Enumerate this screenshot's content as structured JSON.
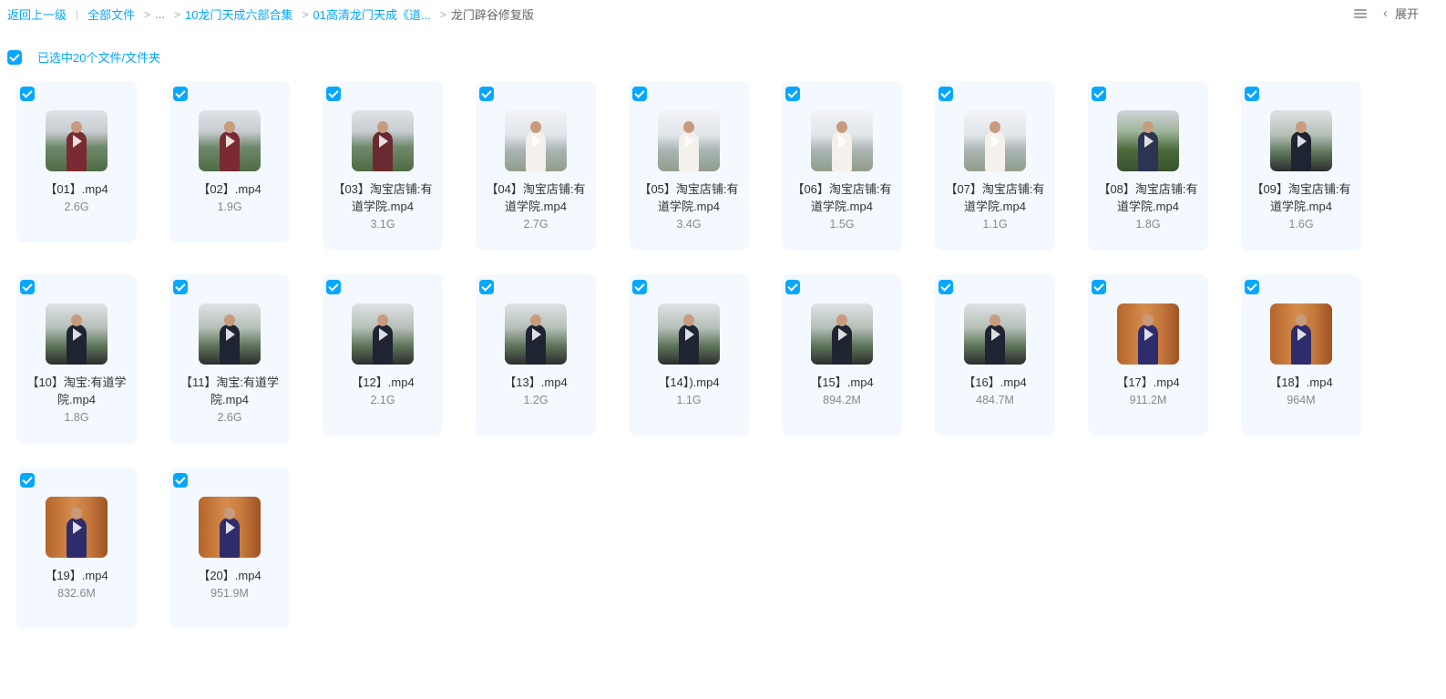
{
  "breadcrumb": {
    "back_label": "返回上一级",
    "items": [
      "全部文件",
      "...",
      "10龙门天成六部合集",
      "01高清龙门天成《道..."
    ],
    "current": "龙门辟谷修复版"
  },
  "toolbar": {
    "expand_label": "展开"
  },
  "selection": {
    "text": "已选中20个文件/文件夹"
  },
  "colors": {
    "accent": "#06a7ff",
    "card_bg": "#f3f9ff"
  },
  "files": [
    {
      "name": "【01】.mp4",
      "size": "2.6G",
      "thumb": "bg-mountain",
      "robe": "#7a2a32"
    },
    {
      "name": "【02】.mp4",
      "size": "1.9G",
      "thumb": "bg-mountain",
      "robe": "#7a2a32"
    },
    {
      "name": "【03】淘宝店铺:有道学院.mp4",
      "size": "3.1G",
      "thumb": "bg-mountain",
      "robe": "#6b2a30"
    },
    {
      "name": "【04】淘宝店铺:有道学院.mp4",
      "size": "2.7G",
      "thumb": "bg-mist",
      "robe": "#f4f0ec"
    },
    {
      "name": "【05】淘宝店铺:有道学院.mp4",
      "size": "3.4G",
      "thumb": "bg-mist",
      "robe": "#f4f0ec"
    },
    {
      "name": "【06】淘宝店铺:有道学院.mp4",
      "size": "1.5G",
      "thumb": "bg-mist",
      "robe": "#f4f0ec"
    },
    {
      "name": "【07】淘宝店铺:有道学院.mp4",
      "size": "1.1G",
      "thumb": "bg-mist",
      "robe": "#f4f0ec"
    },
    {
      "name": "【08】淘宝店铺:有道学院.mp4",
      "size": "1.8G",
      "thumb": "bg-forest",
      "robe": "#2b3450"
    },
    {
      "name": "【09】淘宝店铺:有道学院.mp4",
      "size": "1.6G",
      "thumb": "bg-rail",
      "robe": "#1f2433"
    },
    {
      "name": "【10】淘宝:有道学院.mp4",
      "size": "1.8G",
      "thumb": "bg-rail",
      "robe": "#1f2433"
    },
    {
      "name": "【11】淘宝:有道学院.mp4",
      "size": "2.6G",
      "thumb": "bg-rail",
      "robe": "#1f2433"
    },
    {
      "name": "【12】.mp4",
      "size": "2.1G",
      "thumb": "bg-rail",
      "robe": "#1f2433"
    },
    {
      "name": "【13】.mp4",
      "size": "1.2G",
      "thumb": "bg-rail",
      "robe": "#1f2433"
    },
    {
      "name": "【14】).mp4",
      "size": "1.1G",
      "thumb": "bg-rail",
      "robe": "#1f2433"
    },
    {
      "name": "【15】.mp4",
      "size": "894.2M",
      "thumb": "bg-rail",
      "robe": "#1f2433"
    },
    {
      "name": "【16】.mp4",
      "size": "484.7M",
      "thumb": "bg-rail",
      "robe": "#1f2433"
    },
    {
      "name": "【17】.mp4",
      "size": "911.2M",
      "thumb": "bg-wood",
      "robe": "#2e2c6b"
    },
    {
      "name": "【18】.mp4",
      "size": "964M",
      "thumb": "bg-wood",
      "robe": "#2e2c6b"
    },
    {
      "name": "【19】.mp4",
      "size": "832.6M",
      "thumb": "bg-wood",
      "robe": "#2e2c6b"
    },
    {
      "name": "【20】.mp4",
      "size": "951.9M",
      "thumb": "bg-wood",
      "robe": "#2e2c6b"
    }
  ]
}
